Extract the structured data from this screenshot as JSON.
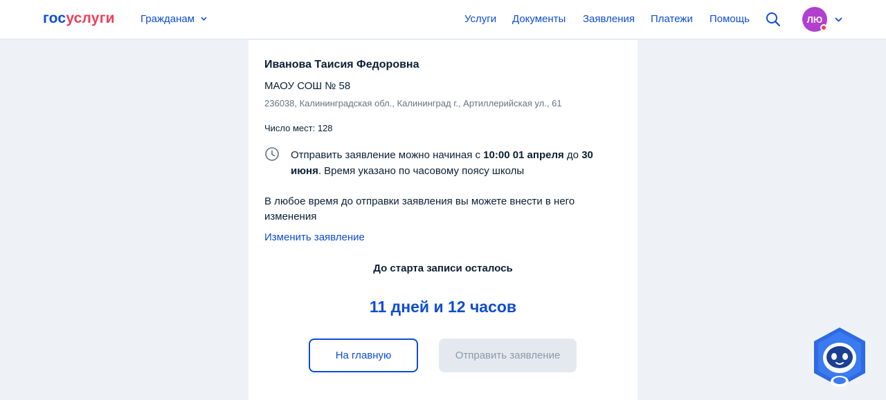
{
  "header": {
    "logo_part1": "гос",
    "logo_part2": "услуги",
    "citizens_label": "Гражданам",
    "nav": {
      "services": "Услуги",
      "documents": "Документы",
      "applications": "Заявления",
      "payments": "Платежи",
      "help": "Помощь"
    },
    "avatar_initials": "ЛЮ"
  },
  "card": {
    "name": "Иванова Таисия Федоровна",
    "school": "МАОУ СОШ № 58",
    "address": "236038, Калининградская обл., Калининград г., Артиллерийская ул., 61",
    "places_text": "Число мест: 128",
    "notice": {
      "part1": "Отправить заявление можно начиная с ",
      "start": "10:00 01 апреля",
      "part2": " до ",
      "end": "30 июня",
      "part3": ". Время указано по часовому поясу школы"
    },
    "changes_text": "В любое время до отправки заявления вы можете внести в него изменения",
    "edit_link": "Изменить заявление",
    "countdown_label": "До старта записи осталось",
    "countdown_value": "11 дней и 12 часов",
    "home_button": "На главную",
    "send_button": "Отправить заявление"
  },
  "colors": {
    "primary": "#0d4cd3",
    "logo_accent": "#ee3f58",
    "avatar": "#b13fcf",
    "page_bg": "#eef2f7",
    "disabled_bg": "#e4e9f0"
  },
  "icons": {
    "search": "search-icon",
    "clock": "clock-icon",
    "chevron": "chevron-down-icon",
    "assistant": "robot-assistant-icon"
  }
}
